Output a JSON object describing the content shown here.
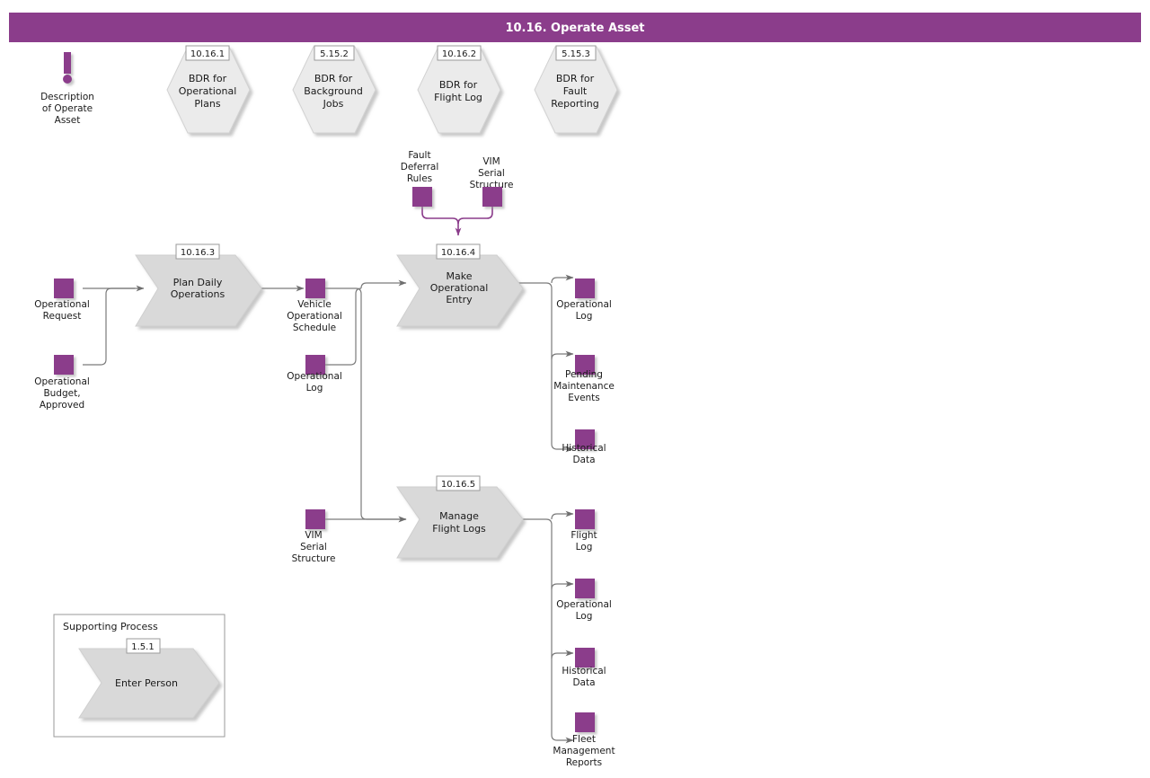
{
  "header": {
    "title": "10.16. Operate Asset",
    "bar_color": "#8B3D8B",
    "title_color": "#FFFFFF"
  },
  "theme": {
    "accent_purple": "#8B3D8B",
    "object_square": "#8B3D8B",
    "process_fill": "#D9D9D9",
    "hexagon_fill": "#EBEBEB",
    "connector_gray": "#7A7A7A",
    "tag_fill": "#FFFFFF",
    "tag_border": "#9A9A9A",
    "canvas": "#FFFFFF"
  },
  "description": {
    "icon": "exclamation-icon",
    "label_line1": "Description",
    "label_line2": "of Operate",
    "label_line3": "Asset"
  },
  "bdr_hexagons": [
    {
      "tag": "10.16.1",
      "lines": [
        "BDR for",
        "Operational",
        "Plans"
      ]
    },
    {
      "tag": "5.15.2",
      "lines": [
        "BDR for",
        "Background",
        "Jobs"
      ]
    },
    {
      "tag": "10.16.2",
      "lines": [
        "BDR for",
        "Flight Log"
      ]
    },
    {
      "tag": "5.15.3",
      "lines": [
        "BDR for",
        "Fault",
        "Reporting"
      ]
    }
  ],
  "processes": [
    {
      "tag": "10.16.3",
      "lines": [
        "Plan Daily",
        "Operations"
      ]
    },
    {
      "tag": "10.16.4",
      "lines": [
        "Make",
        "Operational",
        "Entry"
      ]
    },
    {
      "tag": "10.16.5",
      "lines": [
        "Manage",
        "Flight Logs"
      ]
    }
  ],
  "control_objects": [
    {
      "lines": [
        "Fault",
        "Deferral",
        "Rules"
      ]
    },
    {
      "lines": [
        "VIM",
        "Serial",
        "Structure"
      ]
    }
  ],
  "inputs_left": [
    {
      "lines": [
        "Operational",
        "Request"
      ]
    },
    {
      "lines": [
        "Operational",
        "Budget,",
        "Approved"
      ]
    }
  ],
  "middle_objects": [
    {
      "lines": [
        "Vehicle",
        "Operational",
        "Schedule"
      ]
    },
    {
      "lines": [
        "Operational",
        "Log"
      ]
    },
    {
      "lines": [
        "VIM",
        "Serial",
        "Structure"
      ]
    }
  ],
  "outputs_entry": [
    {
      "lines": [
        "Operational",
        "Log"
      ]
    },
    {
      "lines": [
        "Pending",
        "Maintenance",
        "Events"
      ]
    },
    {
      "lines": [
        "Historical",
        "Data"
      ]
    }
  ],
  "outputs_flightlogs": [
    {
      "lines": [
        "Flight",
        "Log"
      ]
    },
    {
      "lines": [
        "Operational",
        "Log"
      ]
    },
    {
      "lines": [
        "Historical",
        "Data"
      ]
    },
    {
      "lines": [
        "Fleet",
        "Management",
        "Reports"
      ]
    }
  ],
  "supporting_process": {
    "group_label": "Supporting Process",
    "tag": "1.5.1",
    "label": "Enter Person"
  }
}
